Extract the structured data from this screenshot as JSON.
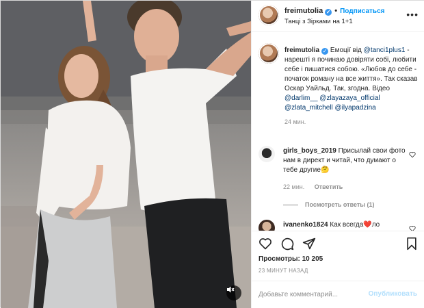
{
  "post": {
    "username": "freimutolia",
    "follow_label": "Подписаться",
    "location": "Танці з Зірками на 1+1",
    "caption": {
      "username": "freimutolia",
      "text_1": "Емоції від",
      "mention_1": "@tanci1plus1",
      "text_2": " - нарешті я починаю довіряти собі, любити себе і пишатися собою. «Любов до себе - початок роману на все життя». Так сказав Оскар Уайльд. Так, згодна. Відео ",
      "mention_2": "@darlim__",
      "mention_3": "@zlayazaya_official",
      "mention_4": "@zlata_mitchell",
      "mention_5": "@ilyapadzina",
      "time": "24 мин."
    },
    "comments": [
      {
        "username": "girls_boys_2019",
        "text": "Присылай свои фото нам в директ и читай, что думают о тебе другие🤔",
        "time": "22 мин.",
        "reply_label": "Ответить",
        "view_replies": "Посмотреть ответы (1)"
      },
      {
        "username": "ivanenko1824",
        "text": "Как всегда❤️ло"
      }
    ],
    "views": "Просмотры: 10 205",
    "posted_ago": "23 МИНУТ НАЗАД",
    "comment_placeholder": "Добавьте комментарий...",
    "publish_label": "Опубликовать"
  },
  "icons": {
    "like": "heart-icon",
    "comment": "comment-icon",
    "share": "paper-plane-icon",
    "save": "bookmark-icon",
    "mute": "muted-speaker-icon",
    "more": "more-options-icon",
    "verified": "verified-badge-icon"
  },
  "colors": {
    "link": "#00376b",
    "follow": "#0095f6",
    "verified": "#3897f0",
    "publish_disabled": "#b2dffc",
    "heart": "#ed4956"
  }
}
